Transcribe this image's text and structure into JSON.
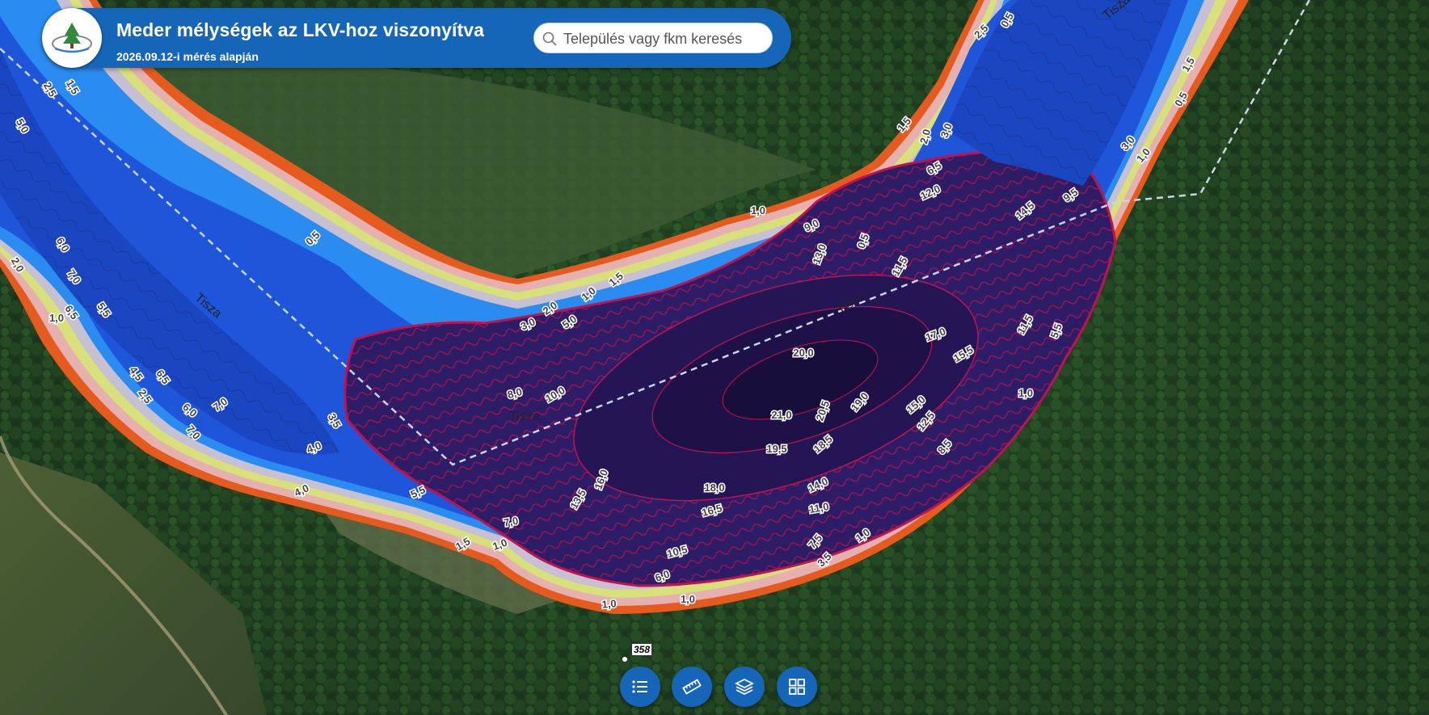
{
  "header": {
    "title": "Meder mélységek az LKV-hoz viszonyítva",
    "subtitle": "2026.09.12-i mérés alapján",
    "logo_icon": "tree-logo-icon"
  },
  "search": {
    "placeholder": "Település vagy fkm keresés",
    "value": "",
    "icon": "search-icon"
  },
  "map": {
    "river_labels": [
      "Tisza",
      "Tisza",
      "Tisza",
      "Tisza"
    ],
    "depth_labels": [
      "5,0",
      "2,5",
      "1,5",
      "6,0",
      "2,0",
      "7,0",
      "6,5",
      "5,5",
      "1,0",
      "0,5",
      "4,5",
      "6,5",
      "2,5",
      "6,0",
      "7,0",
      "7,0",
      "3,5",
      "4,0",
      "4,0",
      "5,5",
      "7,0",
      "1,5",
      "1,0",
      "3,0",
      "2,0",
      "5,0",
      "1,0",
      "1,5",
      "1,0",
      "9,0",
      "13,0",
      "12,0",
      "6,5",
      "2,0",
      "3,0",
      "1,5",
      "0,5",
      "2,5",
      "0,5",
      "1,5",
      "0,5",
      "3,0",
      "1,0",
      "9,5",
      "14,5",
      "11,5",
      "8,0",
      "10,0",
      "20,0",
      "17,0",
      "15,5",
      "11,5",
      "5,5",
      "16,0",
      "13,5",
      "21,0",
      "20,5",
      "19,0",
      "19,5",
      "18,5",
      "15,0",
      "12,5",
      "1,0",
      "8,5",
      "18,0",
      "16,5",
      "14,0",
      "11,0",
      "10,5",
      "6,0",
      "7,5",
      "1,0",
      "3,5",
      "1,0",
      "1,0"
    ],
    "km_marker": "358",
    "colors": {
      "deep": "#2d1d66",
      "mid": "#1f55d8",
      "shallow": "#2a8cf0",
      "contour": "#c0124f",
      "bank_orange": "#e65a1e",
      "bank_yellow": "#d8e07a",
      "bank_pink": "#e4b0b0"
    }
  },
  "toolbar": {
    "buttons": [
      {
        "name": "legend-button",
        "icon": "list-icon"
      },
      {
        "name": "measure-button",
        "icon": "ruler-icon"
      },
      {
        "name": "layers-button",
        "icon": "layers-icon"
      },
      {
        "name": "basemap-gallery-button",
        "icon": "grid-icon"
      }
    ]
  }
}
